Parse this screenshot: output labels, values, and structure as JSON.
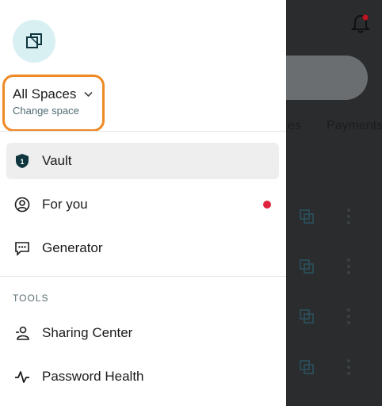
{
  "background": {
    "tabs": [
      "es",
      "Payments"
    ],
    "row_count": 4
  },
  "drawer": {
    "space_selector": {
      "title": "All Spaces",
      "subtitle": "Change space"
    },
    "nav": [
      {
        "label": "Vault",
        "icon": "vault-shield-icon",
        "active": true
      },
      {
        "label": "For you",
        "icon": "user-circle-icon",
        "badge": true
      },
      {
        "label": "Generator",
        "icon": "generator-icon"
      }
    ],
    "tools_header": "TOOLS",
    "tools": [
      {
        "label": "Sharing Center",
        "icon": "sharing-center-icon"
      },
      {
        "label": "Password Health",
        "icon": "pulse-icon"
      }
    ]
  },
  "colors": {
    "accent_outline": "#ee8a26",
    "notification_dot": "#e0243d",
    "brand_teal": "#0e353d",
    "logo_bg": "#d9f0f3"
  }
}
